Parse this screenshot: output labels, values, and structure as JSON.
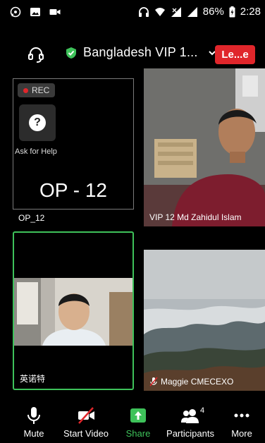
{
  "status_bar": {
    "battery": "86%",
    "time": "2:28"
  },
  "top_bar": {
    "meeting_title": "Bangladesh VIP 1...",
    "leave_label": "Le...e",
    "colors": {
      "leave_bg": "#e0262b",
      "secure_green": "#3ec25a"
    }
  },
  "tiles": {
    "self": {
      "rec_label": "REC",
      "help_label": "Ask for Help",
      "display_name": "OP - 12",
      "user_label": "OP_12"
    },
    "vip": {
      "name": "VIP 12 Md Zahidul Islam"
    },
    "active": {
      "name": "英诺特"
    },
    "landscape": {
      "name": "Maggie CMECEXO"
    }
  },
  "toolbar": {
    "mute": "Mute",
    "start_video": "Start Video",
    "share": "Share",
    "participants": "Participants",
    "participants_count": "4",
    "more": "More"
  }
}
